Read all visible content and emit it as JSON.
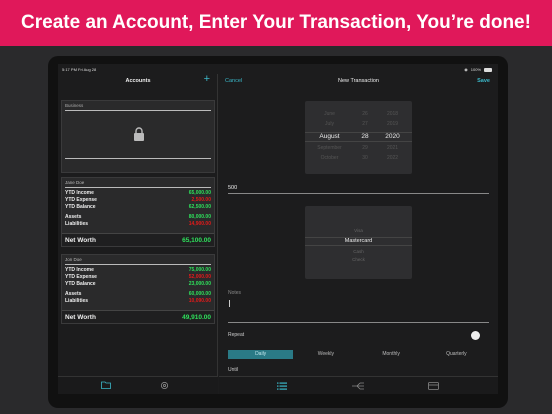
{
  "banner": {
    "text": "Create an Account, Enter Your Transaction, You’re done!"
  },
  "status": {
    "time": "5:17 PM  Fri Aug 28",
    "battery": "100%"
  },
  "accounts_pane": {
    "title": "Accounts",
    "add_label": "+",
    "locked_card": {
      "title": "Business"
    },
    "accounts": [
      {
        "name": "Jane Doe",
        "rows": [
          {
            "label": "YTD Income",
            "value": "65,000.00",
            "color": "green"
          },
          {
            "label": "YTD Expense",
            "value": "2,500.00",
            "color": "red"
          },
          {
            "label": "YTD Balance",
            "value": "62,500.00",
            "color": "green"
          },
          {
            "label": "Assets",
            "value": "80,000.00",
            "color": "green"
          },
          {
            "label": "Liabilities",
            "value": "14,900.00",
            "color": "red"
          }
        ],
        "net_worth_label": "Net Worth",
        "net_worth": "65,100.00"
      },
      {
        "name": "Jon Doe",
        "rows": [
          {
            "label": "YTD Income",
            "value": "75,000.00",
            "color": "green"
          },
          {
            "label": "YTD Expense",
            "value": "52,000.00",
            "color": "red"
          },
          {
            "label": "YTD Balance",
            "value": "23,000.00",
            "color": "green"
          },
          {
            "label": "Assets",
            "value": "60,000.00",
            "color": "green"
          },
          {
            "label": "Liabilities",
            "value": "10,090.00",
            "color": "red"
          }
        ],
        "net_worth_label": "Net Worth",
        "net_worth": "49,910.00"
      }
    ],
    "tabs": [
      {
        "icon": "folder-icon"
      },
      {
        "icon": "gear-icon"
      }
    ]
  },
  "transaction_pane": {
    "cancel_label": "Cancel",
    "title": "New Transaction",
    "save_label": "Save",
    "date_picker": {
      "months": [
        "June",
        "July",
        "August",
        "September",
        "October"
      ],
      "days": [
        "26",
        "27",
        "28",
        "29",
        "30"
      ],
      "years": [
        "2018",
        "2019",
        "2020",
        "2021",
        "2022"
      ],
      "selected_index": 2
    },
    "amount_value": "500",
    "payment_methods": [
      "Visa",
      "Mastercard",
      "Cash",
      "Check"
    ],
    "selected_payment_index": 1,
    "notes_label": "Notes",
    "repeat_label": "Repeat",
    "frequency_options": [
      "Daily",
      "Weekly",
      "Monthly",
      "Quarterly"
    ],
    "selected_frequency_index": 0,
    "until_label": "Until",
    "tabs": [
      {
        "icon": "list-icon"
      },
      {
        "icon": "category-icon"
      },
      {
        "icon": "card-icon"
      }
    ]
  },
  "colors": {
    "banner": "#e0185a",
    "accent": "#3bb8c9",
    "positive": "#2ee05b",
    "negative": "#e51a1a"
  }
}
